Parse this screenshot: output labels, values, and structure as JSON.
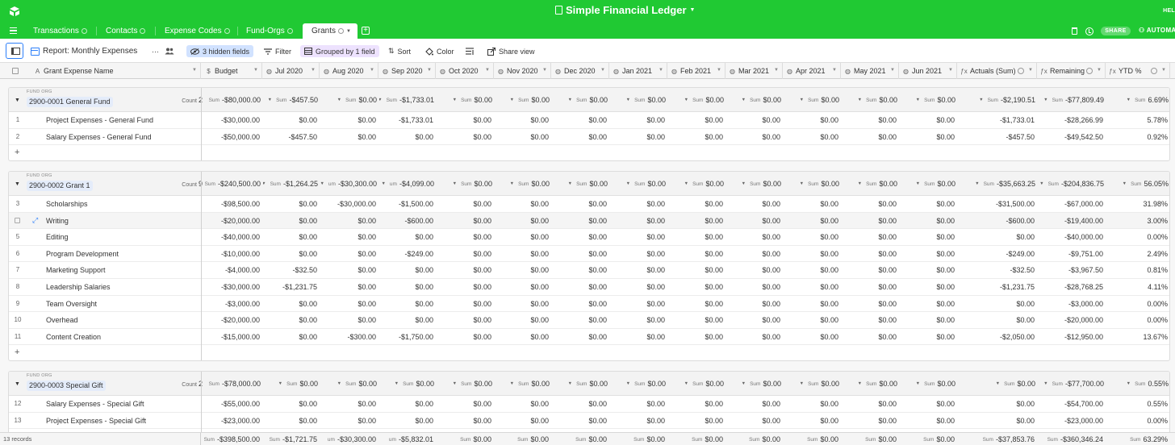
{
  "app": {
    "title": "Simple Financial Ledger",
    "help_text": "HEL",
    "share_label": "SHARE",
    "automate_label": "AUTOMA",
    "accent": "#20c933"
  },
  "tabs": [
    {
      "label": "Transactions"
    },
    {
      "label": "Contacts"
    },
    {
      "label": "Expense Codes"
    },
    {
      "label": "Fund-Orgs"
    },
    {
      "label": "Grants",
      "active": true
    }
  ],
  "toolbar": {
    "view_name": "Report: Monthly Expenses",
    "more_label": "···",
    "hidden_fields": "3 hidden fields",
    "filter": "Filter",
    "grouped": "Grouped by 1 field",
    "sort": "Sort",
    "color": "Color",
    "share_view": "Share view"
  },
  "columns": [
    {
      "label": "Grant Expense Name",
      "icon": "A"
    },
    {
      "label": "Budget",
      "icon": "$"
    },
    {
      "label": "Jul 2020",
      "icon": "◍"
    },
    {
      "label": "Aug 2020",
      "icon": "◍"
    },
    {
      "label": "Sep 2020",
      "icon": "◍"
    },
    {
      "label": "Oct 2020",
      "icon": "◍"
    },
    {
      "label": "Nov 2020",
      "icon": "◍"
    },
    {
      "label": "Dec 2020",
      "icon": "◍"
    },
    {
      "label": "Jan 2021",
      "icon": "◍"
    },
    {
      "label": "Feb 2021",
      "icon": "◍"
    },
    {
      "label": "Mar 2021",
      "icon": "◍"
    },
    {
      "label": "Apr 2021",
      "icon": "◍"
    },
    {
      "label": "May 2021",
      "icon": "◍"
    },
    {
      "label": "Jun 2021",
      "icon": "◍"
    },
    {
      "label": "Actuals (Sum)",
      "icon": "ƒx"
    },
    {
      "label": "Remaining",
      "icon": "ƒx"
    },
    {
      "label": "YTD %",
      "icon": "ƒx"
    }
  ],
  "group_field_label": "FUND ORG",
  "count_label": "Count",
  "sum_label": "Sum",
  "groups": [
    {
      "name": "2900-0001 General Fund",
      "count": "2",
      "sum_labels": [
        "Sum",
        "Sum",
        "Sum",
        "Sum",
        "Sum",
        "Sum",
        "Sum",
        "Sum",
        "Sum",
        "Sum",
        "Sum",
        "Sum",
        "Sum",
        "Sum",
        "Sum",
        "Sum"
      ],
      "sums": [
        "-$80,000.00",
        "-$457.50",
        "$0.00",
        "-$1,733.01",
        "$0.00",
        "$0.00",
        "$0.00",
        "$0.00",
        "$0.00",
        "$0.00",
        "$0.00",
        "$0.00",
        "$0.00",
        "-$2,190.51",
        "-$77,809.49",
        "6.69%"
      ],
      "rows": [
        {
          "num": "1",
          "name": "Project Expenses - General Fund",
          "values": [
            "-$30,000.00",
            "$0.00",
            "$0.00",
            "-$1,733.01",
            "$0.00",
            "$0.00",
            "$0.00",
            "$0.00",
            "$0.00",
            "$0.00",
            "$0.00",
            "$0.00",
            "$0.00",
            "-$1,733.01",
            "-$28,266.99",
            "5.78%"
          ]
        },
        {
          "num": "2",
          "name": "Salary Expenses - General Fund",
          "values": [
            "-$50,000.00",
            "-$457.50",
            "$0.00",
            "$0.00",
            "$0.00",
            "$0.00",
            "$0.00",
            "$0.00",
            "$0.00",
            "$0.00",
            "$0.00",
            "$0.00",
            "$0.00",
            "-$457.50",
            "-$49,542.50",
            "0.92%"
          ]
        }
      ]
    },
    {
      "name": "2900-0002 Grant 1",
      "count": "9",
      "sum_labels": [
        "Sum",
        "Sum",
        "um",
        "um",
        "Sum",
        "Sum",
        "Sum",
        "Sum",
        "Sum",
        "Sum",
        "Sum",
        "Sum",
        "Sum",
        "Sum",
        "Sum",
        "Sum"
      ],
      "sums": [
        "-$240,500.00",
        "-$1,264.25",
        "-$30,300.00",
        "-$4,099.00",
        "$0.00",
        "$0.00",
        "$0.00",
        "$0.00",
        "$0.00",
        "$0.00",
        "$0.00",
        "$0.00",
        "$0.00",
        "-$35,663.25",
        "-$204,836.75",
        "56.05%"
      ],
      "rows": [
        {
          "num": "3",
          "name": "Scholarships",
          "values": [
            "-$98,500.00",
            "$0.00",
            "-$30,000.00",
            "-$1,500.00",
            "$0.00",
            "$0.00",
            "$0.00",
            "$0.00",
            "$0.00",
            "$0.00",
            "$0.00",
            "$0.00",
            "$0.00",
            "-$31,500.00",
            "-$67,000.00",
            "31.98%"
          ]
        },
        {
          "num": "",
          "name": "Writing",
          "hover": true,
          "values": [
            "-$20,000.00",
            "$0.00",
            "$0.00",
            "-$600.00",
            "$0.00",
            "$0.00",
            "$0.00",
            "$0.00",
            "$0.00",
            "$0.00",
            "$0.00",
            "$0.00",
            "$0.00",
            "-$600.00",
            "-$19,400.00",
            "3.00%"
          ]
        },
        {
          "num": "5",
          "name": "Editing",
          "values": [
            "-$40,000.00",
            "$0.00",
            "$0.00",
            "$0.00",
            "$0.00",
            "$0.00",
            "$0.00",
            "$0.00",
            "$0.00",
            "$0.00",
            "$0.00",
            "$0.00",
            "$0.00",
            "$0.00",
            "-$40,000.00",
            "0.00%"
          ]
        },
        {
          "num": "6",
          "name": "Program Development",
          "values": [
            "-$10,000.00",
            "$0.00",
            "$0.00",
            "-$249.00",
            "$0.00",
            "$0.00",
            "$0.00",
            "$0.00",
            "$0.00",
            "$0.00",
            "$0.00",
            "$0.00",
            "$0.00",
            "-$249.00",
            "-$9,751.00",
            "2.49%"
          ]
        },
        {
          "num": "7",
          "name": "Marketing Support",
          "values": [
            "-$4,000.00",
            "-$32.50",
            "$0.00",
            "$0.00",
            "$0.00",
            "$0.00",
            "$0.00",
            "$0.00",
            "$0.00",
            "$0.00",
            "$0.00",
            "$0.00",
            "$0.00",
            "-$32.50",
            "-$3,967.50",
            "0.81%"
          ]
        },
        {
          "num": "8",
          "name": "Leadership Salaries",
          "values": [
            "-$30,000.00",
            "-$1,231.75",
            "$0.00",
            "$0.00",
            "$0.00",
            "$0.00",
            "$0.00",
            "$0.00",
            "$0.00",
            "$0.00",
            "$0.00",
            "$0.00",
            "$0.00",
            "-$1,231.75",
            "-$28,768.25",
            "4.11%"
          ]
        },
        {
          "num": "9",
          "name": "Team Oversight",
          "values": [
            "-$3,000.00",
            "$0.00",
            "$0.00",
            "$0.00",
            "$0.00",
            "$0.00",
            "$0.00",
            "$0.00",
            "$0.00",
            "$0.00",
            "$0.00",
            "$0.00",
            "$0.00",
            "$0.00",
            "-$3,000.00",
            "0.00%"
          ]
        },
        {
          "num": "10",
          "name": "Overhead",
          "values": [
            "-$20,000.00",
            "$0.00",
            "$0.00",
            "$0.00",
            "$0.00",
            "$0.00",
            "$0.00",
            "$0.00",
            "$0.00",
            "$0.00",
            "$0.00",
            "$0.00",
            "$0.00",
            "$0.00",
            "-$20,000.00",
            "0.00%"
          ]
        },
        {
          "num": "11",
          "name": "Content Creation",
          "values": [
            "-$15,000.00",
            "$0.00",
            "-$300.00",
            "-$1,750.00",
            "$0.00",
            "$0.00",
            "$0.00",
            "$0.00",
            "$0.00",
            "$0.00",
            "$0.00",
            "$0.00",
            "$0.00",
            "-$2,050.00",
            "-$12,950.00",
            "13.67%"
          ]
        }
      ]
    },
    {
      "name": "2900-0003 Special Gift",
      "count": "2",
      "sum_labels": [
        "Sum",
        "Sum",
        "Sum",
        "Sum",
        "Sum",
        "Sum",
        "Sum",
        "Sum",
        "Sum",
        "Sum",
        "Sum",
        "Sum",
        "Sum",
        "Sum",
        "Sum",
        "Sum"
      ],
      "sums": [
        "-$78,000.00",
        "$0.00",
        "$0.00",
        "$0.00",
        "$0.00",
        "$0.00",
        "$0.00",
        "$0.00",
        "$0.00",
        "$0.00",
        "$0.00",
        "$0.00",
        "$0.00",
        "$0.00",
        "-$77,700.00",
        "0.55%"
      ],
      "rows": [
        {
          "num": "12",
          "name": "Salary Expenses - Special Gift",
          "values": [
            "-$55,000.00",
            "$0.00",
            "$0.00",
            "$0.00",
            "$0.00",
            "$0.00",
            "$0.00",
            "$0.00",
            "$0.00",
            "$0.00",
            "$0.00",
            "$0.00",
            "$0.00",
            "$0.00",
            "-$54,700.00",
            "0.55%"
          ]
        },
        {
          "num": "13",
          "name": "Project Expenses - Special Gift",
          "values": [
            "-$23,000.00",
            "$0.00",
            "$0.00",
            "$0.00",
            "$0.00",
            "$0.00",
            "$0.00",
            "$0.00",
            "$0.00",
            "$0.00",
            "$0.00",
            "$0.00",
            "$0.00",
            "$0.00",
            "-$23,000.00",
            "0.00%"
          ]
        }
      ]
    }
  ],
  "footer": {
    "records": "13 records",
    "sum_labels": [
      "Sum",
      "Sum",
      "um",
      "um",
      "Sum",
      "Sum",
      "Sum",
      "Sum",
      "Sum",
      "Sum",
      "Sum",
      "Sum",
      "Sum",
      "Sum",
      "Sum",
      "Sum"
    ],
    "sums": [
      "-$398,500.00",
      "-$1,721.75",
      "-$30,300.00",
      "-$5,832.01",
      "$0.00",
      "$0.00",
      "$0.00",
      "$0.00",
      "$0.00",
      "$0.00",
      "$0.00",
      "$0.00",
      "$0.00",
      "-$37,853.76",
      "-$360,346.24",
      "63.29%"
    ]
  }
}
